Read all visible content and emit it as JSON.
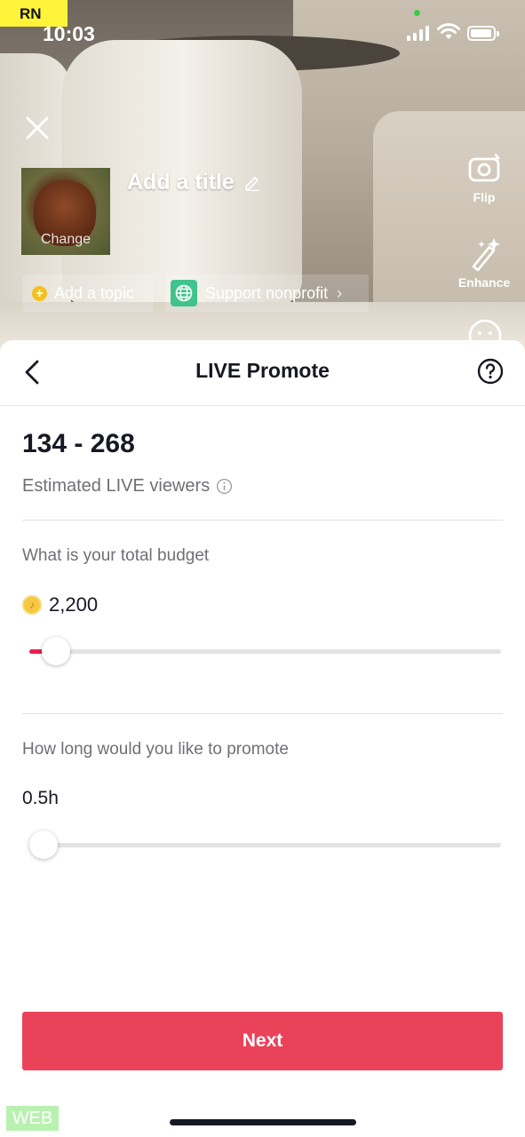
{
  "status_bar": {
    "carrier_tag": "RN",
    "time": "10:03"
  },
  "camera": {
    "thumbnail_label": "Change",
    "title_placeholder": "Add a title",
    "chips": [
      {
        "label": "Add a topic",
        "icon": "plus-circle-icon"
      },
      {
        "label": "Support nonprofit",
        "icon": "globe-icon"
      }
    ],
    "tools": [
      {
        "label": "Flip",
        "icon": "flip-camera-icon"
      },
      {
        "label": "Enhance",
        "icon": "magic-wand-icon"
      },
      {
        "label": "",
        "icon": "face-effects-icon"
      }
    ]
  },
  "sheet": {
    "title": "LIVE Promote",
    "estimated_viewers": "134 - 268",
    "estimated_viewers_label": "Estimated LIVE viewers",
    "budget": {
      "question": "What is your total budget",
      "value": "2,200",
      "slider_fraction": 0.057
    },
    "duration": {
      "question": "How long would you like to promote",
      "value": "0.5h",
      "slider_fraction": 0.03
    },
    "next_label": "Next"
  },
  "footer": {
    "web_tag": "WEB"
  },
  "colors": {
    "accent": "#ea4359",
    "slider_fill": "#ee1d52",
    "coin": "#f5c842",
    "nonprofit_green": "#41c38d"
  }
}
